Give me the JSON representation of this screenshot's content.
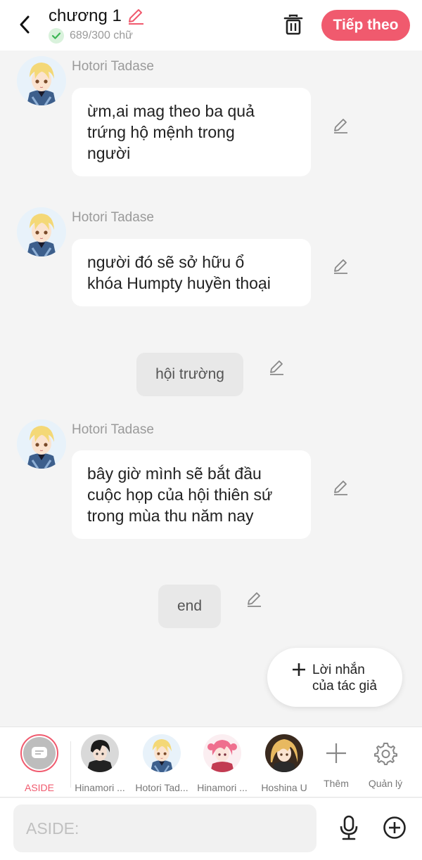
{
  "header": {
    "title": "chương 1",
    "word_count": "689/300 chữ",
    "next_label": "Tiếp theo"
  },
  "messages": [
    {
      "type": "dialogue",
      "sender": "Hotori Tadase",
      "text_lines": [
        "ừm,ai mag theo ba quả",
        "trứng hộ mệnh trong",
        "người"
      ]
    },
    {
      "type": "dialogue",
      "sender": "Hotori Tadase",
      "text_lines": [
        "người đó sẽ sở hữu ổ",
        "khóa Humpty huyền thoại"
      ]
    },
    {
      "type": "narration",
      "text": "hội trường"
    },
    {
      "type": "dialogue",
      "sender": "Hotori Tadase",
      "text_lines": [
        "bây giờ mình sẽ bắt đầu",
        "cuộc họp của hội thiên sứ",
        "trong  mùa thu năm nay"
      ]
    },
    {
      "type": "narration",
      "text": "end"
    }
  ],
  "author_note": {
    "line1": "Lời nhắn",
    "line2": "của tác giả"
  },
  "characters": [
    {
      "name": "ASIDE",
      "selected": true
    },
    {
      "name": "Hinamori ...",
      "icon": "dark-haired-boy-avatar"
    },
    {
      "name": "Hotori Tad...",
      "icon": "blonde-boy-avatar"
    },
    {
      "name": "Hinamori ...",
      "icon": "pink-haired-girl-avatar"
    },
    {
      "name": "Hoshina U",
      "icon": "blonde-girl-avatar"
    },
    {
      "name": "Thêm",
      "icon": "plus-icon"
    },
    {
      "name": "Quản lý",
      "icon": "gear-icon"
    }
  ],
  "input": {
    "placeholder": "ASIDE:"
  },
  "colors": {
    "accent": "#f05a6e",
    "background": "#f4f4f4",
    "bubble": "#ffffff",
    "narration": "#e8e8e8"
  }
}
